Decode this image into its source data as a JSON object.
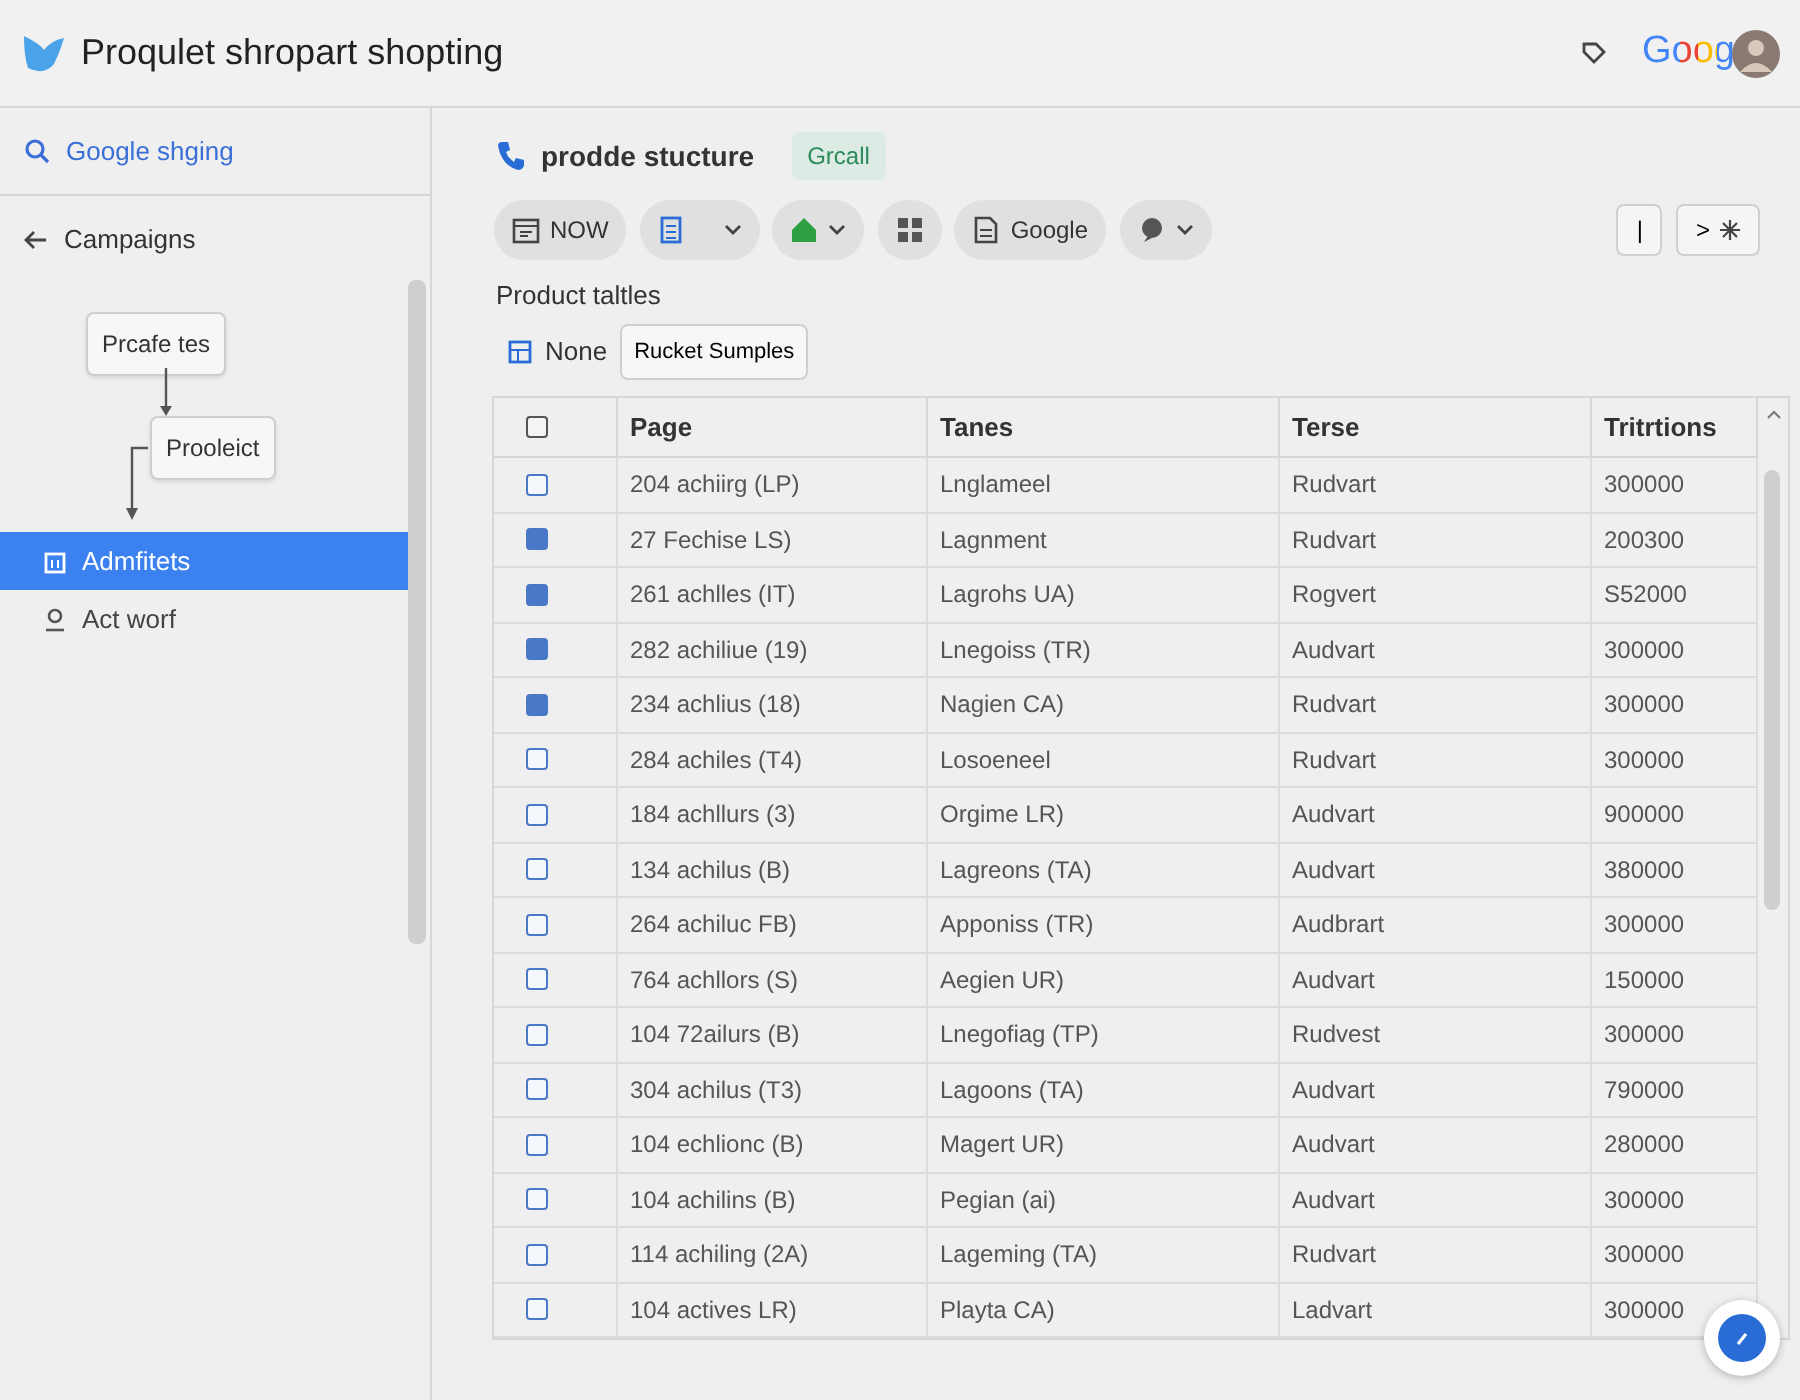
{
  "app_bar": {
    "title": "Proqulet shropart shopting",
    "brand_text": "Goog"
  },
  "sidebar": {
    "search": {
      "value": "Google shging"
    },
    "back_link": "Campaigns",
    "diagram": {
      "nodes": [
        "Prcafe tes",
        "Prooleict"
      ]
    },
    "items": [
      {
        "label": "Admfitets",
        "selected": true
      },
      {
        "label": "Act worf",
        "selected": false
      }
    ]
  },
  "page": {
    "title": "prodde stucture",
    "badge": "Grcall",
    "toolbar": [
      {
        "kind": "calendar",
        "label": "NOW"
      },
      {
        "kind": "list-menu"
      },
      {
        "kind": "home-menu"
      },
      {
        "kind": "grid"
      },
      {
        "kind": "doc",
        "label": "Google"
      },
      {
        "kind": "dot-menu"
      }
    ],
    "nav_buttons": [
      "|",
      ">"
    ]
  },
  "section_title": "Product taltles",
  "filter": {
    "label": "None",
    "value": "Rucket Sumples"
  },
  "table": {
    "columns": [
      "Page",
      "Tanes",
      "Terse",
      "Tritrtions"
    ],
    "header_checked": false,
    "rows": [
      {
        "checked": false,
        "cells": [
          "204 achiirg (LP)",
          "Lnglameel",
          "Rudvart",
          "300000"
        ]
      },
      {
        "checked": true,
        "cells": [
          "27 Fechise LS)",
          "Lagnment",
          "Rudvart",
          "200300"
        ]
      },
      {
        "checked": true,
        "cells": [
          "261 achlles (IT)",
          "Lagrohs UA)",
          "Rogvert",
          "S52000"
        ]
      },
      {
        "checked": true,
        "cells": [
          "282 achiliue (19)",
          "Lnegoiss (TR)",
          "Audvart",
          "300000"
        ]
      },
      {
        "checked": true,
        "cells": [
          "234 achlius (18)",
          "Nagien CA)",
          "Rudvart",
          "300000"
        ]
      },
      {
        "checked": false,
        "cells": [
          "284 achiles (T4)",
          "Losoeneel",
          "Rudvart",
          "300000"
        ]
      },
      {
        "checked": false,
        "cells": [
          "184 achllurs (3)",
          "Orgime LR)",
          "Audvart",
          "900000"
        ]
      },
      {
        "checked": false,
        "cells": [
          "134 achilus (B)",
          "Lagreons (TA)",
          "Audvart",
          "380000"
        ]
      },
      {
        "checked": false,
        "cells": [
          "264 achiluc FB)",
          "Apponiss (TR)",
          "Audbrart",
          "300000"
        ]
      },
      {
        "checked": false,
        "cells": [
          "764 achllors (S)",
          "Aegien UR)",
          "Audvart",
          "150000"
        ]
      },
      {
        "checked": false,
        "cells": [
          "104 72ailurs (B)",
          "Lnegofiag (TP)",
          "Rudvest",
          "300000"
        ]
      },
      {
        "checked": false,
        "cells": [
          "304 achilus (T3)",
          "Lagoons (TA)",
          "Audvart",
          "790000"
        ]
      },
      {
        "checked": false,
        "cells": [
          "104 echlionc (B)",
          "Magert UR)",
          "Audvart",
          "280000"
        ]
      },
      {
        "checked": false,
        "cells": [
          "104 achilins (B)",
          "Pegian (ai)",
          "Audvart",
          "300000"
        ]
      },
      {
        "checked": false,
        "cells": [
          "114 achiling (2A)",
          "Lageming (TA)",
          "Rudvart",
          "300000"
        ]
      },
      {
        "checked": false,
        "cells": [
          "104 actives LR)",
          "Playta CA)",
          "Ladvart",
          "300000"
        ]
      }
    ]
  }
}
